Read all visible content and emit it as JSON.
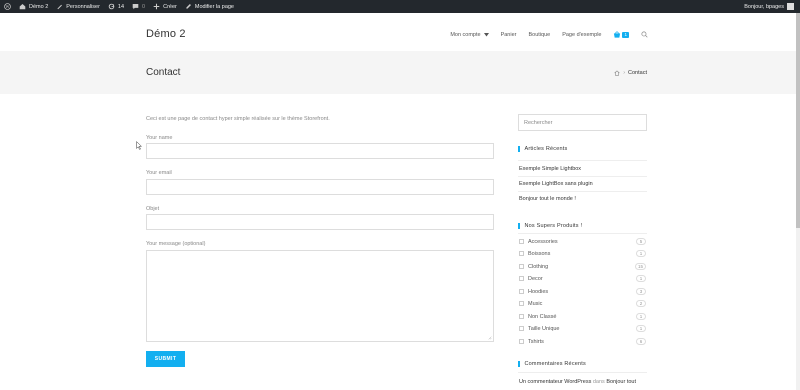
{
  "adminbar": {
    "site_name": "Démo 2",
    "customize": "Personnaliser",
    "updates_count": "14",
    "comments_count": "0",
    "new_label": "Créer",
    "edit_page": "Modifier la page",
    "greeting": "Bonjour, bpages"
  },
  "header": {
    "site_title": "Démo 2",
    "nav": [
      "Mon compte",
      "Panier",
      "Boutique",
      "Page d'exemple"
    ],
    "cart_count": "1"
  },
  "page": {
    "title": "Contact",
    "breadcrumb_current": "Contact"
  },
  "form": {
    "intro": "Ceci est une page de contact hyper simple réalisée sur le thème Storefront.",
    "name_label": "Your name",
    "email_label": "Your email",
    "subject_label": "Objet",
    "message_label": "Your message (optional)",
    "submit": "SUBMIT"
  },
  "sidebar": {
    "search_placeholder": "Rechercher",
    "recent_posts_title": "Articles Récents",
    "recent_posts": [
      "Exemple Simple Lightbox",
      "Exemple LightBox sans plugin",
      "Bonjour tout le monde !"
    ],
    "products_title": "Nos Supers Produits !",
    "categories": [
      {
        "name": "Accessories",
        "count": "5"
      },
      {
        "name": "Boissons",
        "count": "1"
      },
      {
        "name": "Clothing",
        "count": "15"
      },
      {
        "name": "Decor",
        "count": "1"
      },
      {
        "name": "Hoodies",
        "count": "3"
      },
      {
        "name": "Music",
        "count": "2"
      },
      {
        "name": "Non Classé",
        "count": "1"
      },
      {
        "name": "Taille Unique",
        "count": "1"
      },
      {
        "name": "Tshirts",
        "count": "6"
      }
    ],
    "recent_comments_title": "Commentaires Récents",
    "comment_author": "Un commentateur WordPress",
    "comment_on": "dans",
    "comment_post": "Bonjour tout"
  },
  "colors": {
    "accent": "#13aff0",
    "adminbar": "#23282d"
  }
}
